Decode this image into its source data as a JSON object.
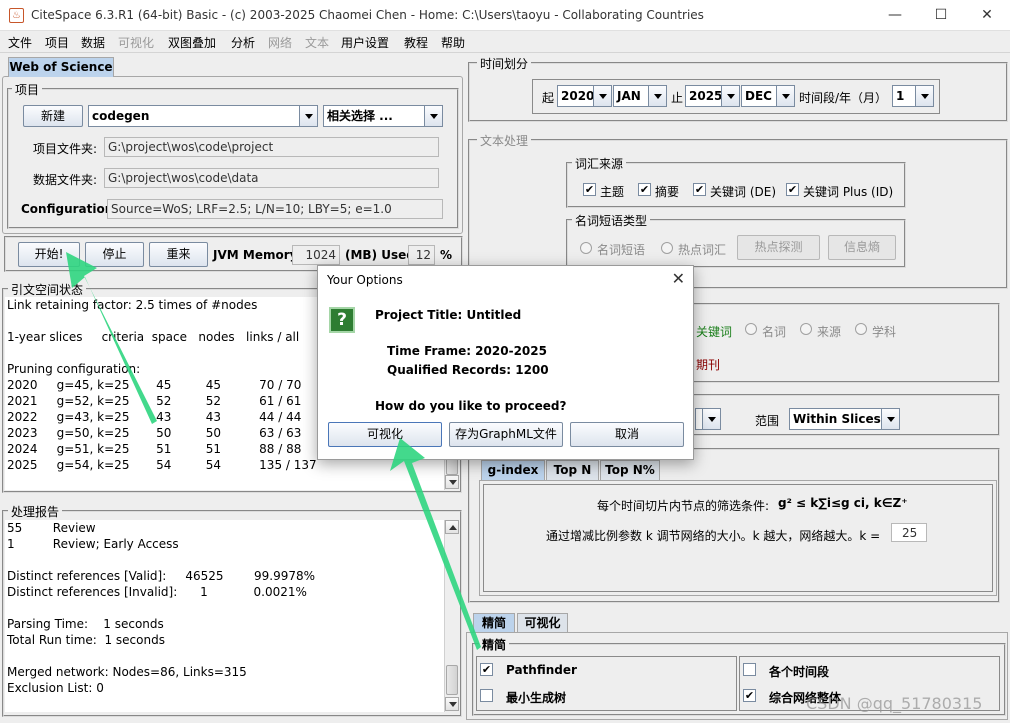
{
  "window": {
    "title": "CiteSpace 6.3.R1 (64-bit) Basic - (c) 2003-2025 Chaomei Chen - Home: C:\\Users\\taoyu - Collaborating Countries"
  },
  "menu": [
    {
      "label": "文件",
      "enabled": true
    },
    {
      "label": "项目",
      "enabled": true
    },
    {
      "label": "数据",
      "enabled": true
    },
    {
      "label": "可视化",
      "enabled": false
    },
    {
      "label": "双图叠加",
      "enabled": true
    },
    {
      "label": "分析",
      "enabled": true
    },
    {
      "label": "网络",
      "enabled": false
    },
    {
      "label": "文本",
      "enabled": false
    },
    {
      "label": "用户设置",
      "enabled": true
    },
    {
      "label": "教程",
      "enabled": true
    },
    {
      "label": "帮助",
      "enabled": true
    }
  ],
  "left": {
    "tab_label": "Web of Science",
    "project_legend": "项目",
    "new_button": "新建",
    "project_name": "codegen",
    "relevance_select": "相关选择 ...",
    "project_folder_label": "项目文件夹:",
    "project_folder": "G:\\project\\wos\\code\\project",
    "data_folder_label": "数据文件夹:",
    "data_folder": "G:\\project\\wos\\code\\data",
    "config_label": "Configuration:",
    "config_value": "Source=WoS; LRF=2.5; L/N=10; LBY=5; e=1.0",
    "start_button": "开始!",
    "stop_button": "停止",
    "reset_button": "重来",
    "jvm_label": "JVM Memory",
    "jvm_value": "1024",
    "used_label": "(MB) Used",
    "used_value": "12",
    "percent": "%",
    "space_legend": "引文空间状态",
    "space_lines": [
      "Link retaining factor: 2.5 times of #nodes",
      "",
      "1-year slices     criteria  space   nodes   links / all",
      "",
      "Pruning configuration:",
      "2020     g=45, k=25       45         45          70 / 70",
      "2021     g=52, k=25       52         52          61 / 61",
      "2022     g=43, k=25       43         43          44 / 44",
      "2023     g=50, k=25       50         50          63 / 63",
      "2024     g=51, k=25       51         51          88 / 88",
      "2025     g=54, k=25       54         54          135 / 137"
    ],
    "report_legend": "处理报告",
    "report_lines": [
      "55        Review",
      "1          Review; Early Access",
      "",
      "Distinct references [Valid]:     46525        99.9978%",
      "Distinct references [Invalid]:      1            0.0021%",
      "",
      "Parsing Time:    1 seconds",
      "Total Run time:  1 seconds",
      "",
      "Merged network: Nodes=86, Links=315",
      "Exclusion List: 0"
    ]
  },
  "right": {
    "time_legend": "时间划分",
    "from_label": "起",
    "from_year": "2020",
    "from_month": "JAN",
    "to_label": "止",
    "to_year": "2025",
    "to_month": "DEC",
    "slice_label": "时间段/年（月）",
    "slice_value": "1",
    "text_legend": "文本处理",
    "term_source_legend": "词汇来源",
    "term_sources": [
      {
        "label": "主题",
        "checked": true
      },
      {
        "label": "摘要",
        "checked": true
      },
      {
        "label": "关键词 (DE)",
        "checked": true
      },
      {
        "label": "关键词 Plus (ID)",
        "checked": true
      }
    ],
    "noun_type_legend": "名词短语类型",
    "noun_phrase": "名词短语",
    "hot_terms": "热点词汇",
    "burst_button": "热点探测",
    "entropy_button": "信息熵",
    "node_types": [
      "关键词",
      "名词",
      "来源",
      "学科"
    ],
    "journal_text": "期刊",
    "scope_label": "范围",
    "scope_value": "Within Slices",
    "sel_tabs": [
      "g-index",
      "Top N",
      "Top N%"
    ],
    "gindex_line1": "每个时间切片内节点的筛选条件:",
    "gindex_formula": "g² ≤ k∑i≤g ci, k∈Z⁺",
    "gindex_line2": "通过增减比例参数 k 调节网络的大小。k 越大，网络越大。k =",
    "k_value": "25",
    "bottom_tabs": [
      "精简",
      "可视化"
    ],
    "prune_legend": "精简",
    "prune_options": [
      {
        "label": "Pathfinder",
        "checked": true
      },
      {
        "label": "最小生成树",
        "checked": false
      },
      {
        "label": "各个时间段",
        "checked": false
      },
      {
        "label": "综合网络整体",
        "checked": true
      }
    ]
  },
  "dialog": {
    "title": "Your Options",
    "project_title": "Project Title: Untitled",
    "time_frame": "Time Frame: 2020-2025",
    "qualified": "Qualified Records: 1200",
    "question": "How do you like to proceed?",
    "visualize_button": "可视化",
    "graphml_button": "存为GraphML文件",
    "cancel_button": "取消"
  },
  "watermark": "CSDN @qq_51780315",
  "colors": {
    "accent_tab": "#bcd3ec",
    "arrow": "#2fd57f",
    "question_icon": "#2e7d32",
    "journal_text": "#8b0000",
    "keyword_text": "#1a7f1a"
  }
}
